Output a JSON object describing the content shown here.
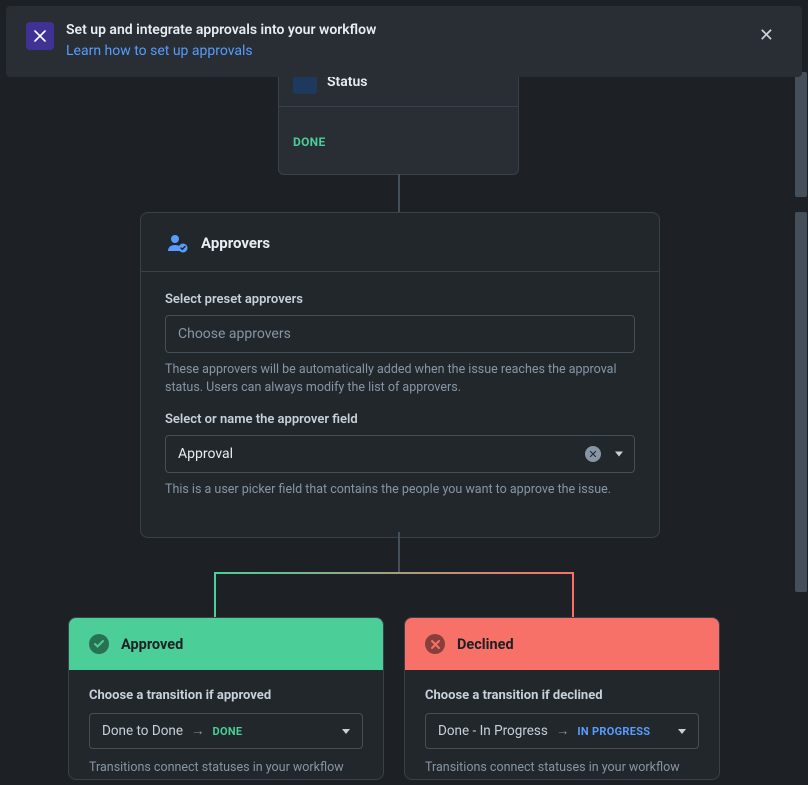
{
  "banner": {
    "title": "Set up and integrate approvals into your workflow",
    "link_text": "Learn how to set up approvals"
  },
  "status_card": {
    "title": "Status",
    "badge": "DONE"
  },
  "approvers": {
    "title": "Approvers",
    "preset_label": "Select preset approvers",
    "preset_placeholder": "Choose approvers",
    "preset_help": "These approvers will be automatically added when the issue reaches the approval status. Users can always modify the list of approvers.",
    "field_label": "Select or name the approver field",
    "field_value": "Approval",
    "field_help": "This is a user picker field that contains the people you want to approve the issue."
  },
  "approved": {
    "title": "Approved",
    "label": "Choose a transition if approved",
    "transition_text": "Done to Done",
    "status": "DONE",
    "help": "Transitions connect statuses in your workflow"
  },
  "declined": {
    "title": "Declined",
    "label": "Choose a transition if declined",
    "transition_text": "Done - In Progress",
    "status": "IN PROGRESS",
    "help": "Transitions connect statuses in your workflow"
  }
}
